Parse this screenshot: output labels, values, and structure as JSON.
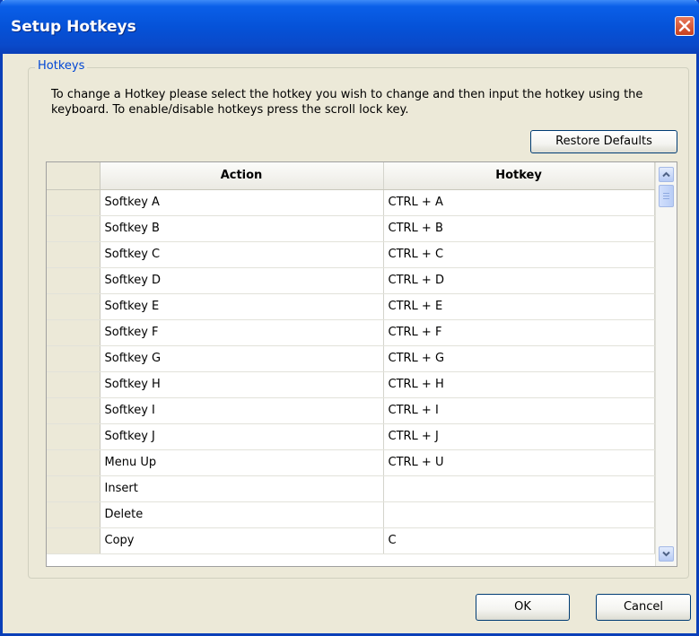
{
  "window": {
    "title": "Setup Hotkeys"
  },
  "group": {
    "label": "Hotkeys",
    "description": "To change a Hotkey please select the hotkey you wish to change and then input the hotkey using the keyboard. To enable/disable hotkeys press the scroll lock key."
  },
  "buttons": {
    "restore_defaults": "Restore Defaults",
    "ok": "OK",
    "cancel": "Cancel"
  },
  "table": {
    "columns": [
      "Action",
      "Hotkey"
    ],
    "rows": [
      {
        "action": "Softkey A",
        "hotkey": "CTRL + A"
      },
      {
        "action": "Softkey B",
        "hotkey": "CTRL + B"
      },
      {
        "action": "Softkey C",
        "hotkey": "CTRL + C"
      },
      {
        "action": "Softkey D",
        "hotkey": "CTRL + D"
      },
      {
        "action": "Softkey E",
        "hotkey": "CTRL + E"
      },
      {
        "action": "Softkey F",
        "hotkey": "CTRL + F"
      },
      {
        "action": "Softkey G",
        "hotkey": "CTRL + G"
      },
      {
        "action": "Softkey H",
        "hotkey": "CTRL + H"
      },
      {
        "action": "Softkey I",
        "hotkey": "CTRL + I"
      },
      {
        "action": "Softkey J",
        "hotkey": "CTRL + J"
      },
      {
        "action": "Menu Up",
        "hotkey": "CTRL + U"
      },
      {
        "action": "Insert",
        "hotkey": ""
      },
      {
        "action": "Delete",
        "hotkey": ""
      },
      {
        "action": "Copy",
        "hotkey": "C"
      }
    ]
  },
  "icons": {
    "close": "close-icon",
    "scroll_up": "chevron-up-icon",
    "scroll_down": "chevron-down-icon"
  },
  "colors": {
    "titlebar": "#0552d8",
    "group_label": "#0046d5",
    "dialog_bg": "#ece9d8"
  }
}
